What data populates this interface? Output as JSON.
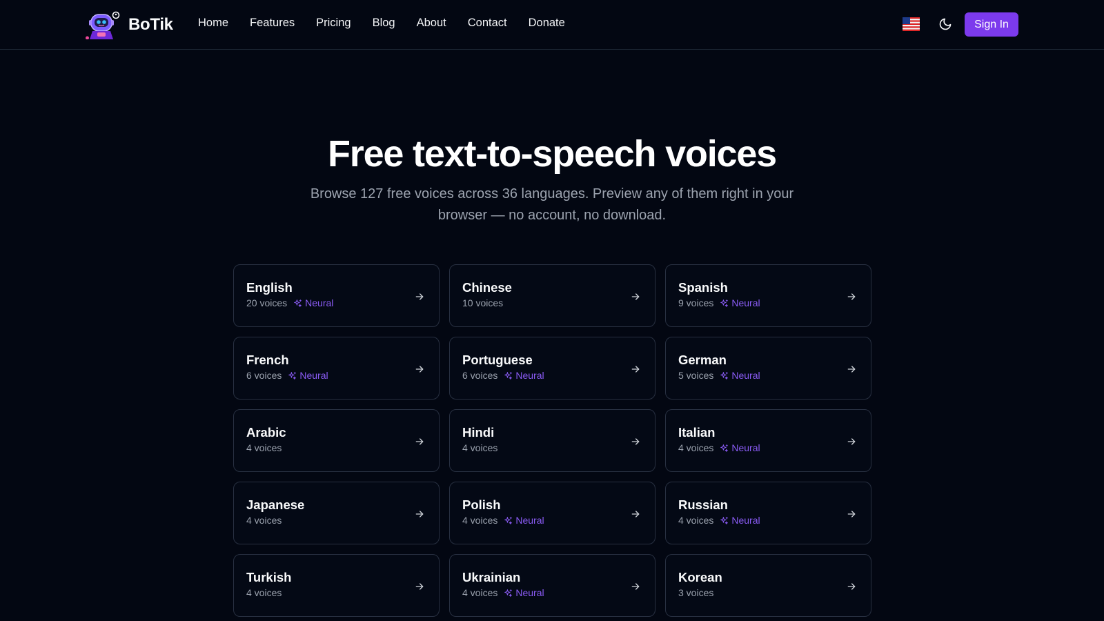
{
  "header": {
    "brand": "BoTik",
    "nav": [
      "Home",
      "Features",
      "Pricing",
      "Blog",
      "About",
      "Contact",
      "Donate"
    ],
    "language_flag": "🇺🇸",
    "theme_icon": "moon-icon",
    "sign_in": "Sign In"
  },
  "hero": {
    "title": "Free text-to-speech voices",
    "subtitle": "Browse 127 free voices across 36 languages. Preview any of them right in your browser — no account, no download."
  },
  "neural_label": "Neural",
  "languages": [
    {
      "name": "English",
      "voices": "20 voices",
      "neural": true
    },
    {
      "name": "Chinese",
      "voices": "10 voices",
      "neural": false
    },
    {
      "name": "Spanish",
      "voices": "9 voices",
      "neural": true
    },
    {
      "name": "French",
      "voices": "6 voices",
      "neural": true
    },
    {
      "name": "Portuguese",
      "voices": "6 voices",
      "neural": true
    },
    {
      "name": "German",
      "voices": "5 voices",
      "neural": true
    },
    {
      "name": "Arabic",
      "voices": "4 voices",
      "neural": false
    },
    {
      "name": "Hindi",
      "voices": "4 voices",
      "neural": false
    },
    {
      "name": "Italian",
      "voices": "4 voices",
      "neural": true
    },
    {
      "name": "Japanese",
      "voices": "4 voices",
      "neural": false
    },
    {
      "name": "Polish",
      "voices": "4 voices",
      "neural": true
    },
    {
      "name": "Russian",
      "voices": "4 voices",
      "neural": true
    },
    {
      "name": "Turkish",
      "voices": "4 voices",
      "neural": false
    },
    {
      "name": "Ukrainian",
      "voices": "4 voices",
      "neural": true
    },
    {
      "name": "Korean",
      "voices": "3 voices",
      "neural": false
    }
  ],
  "colors": {
    "background": "#030712",
    "accent": "#7c3aed",
    "neural": "#8b5cf6",
    "card_border": "#283041",
    "muted_text": "#9ca3af"
  }
}
